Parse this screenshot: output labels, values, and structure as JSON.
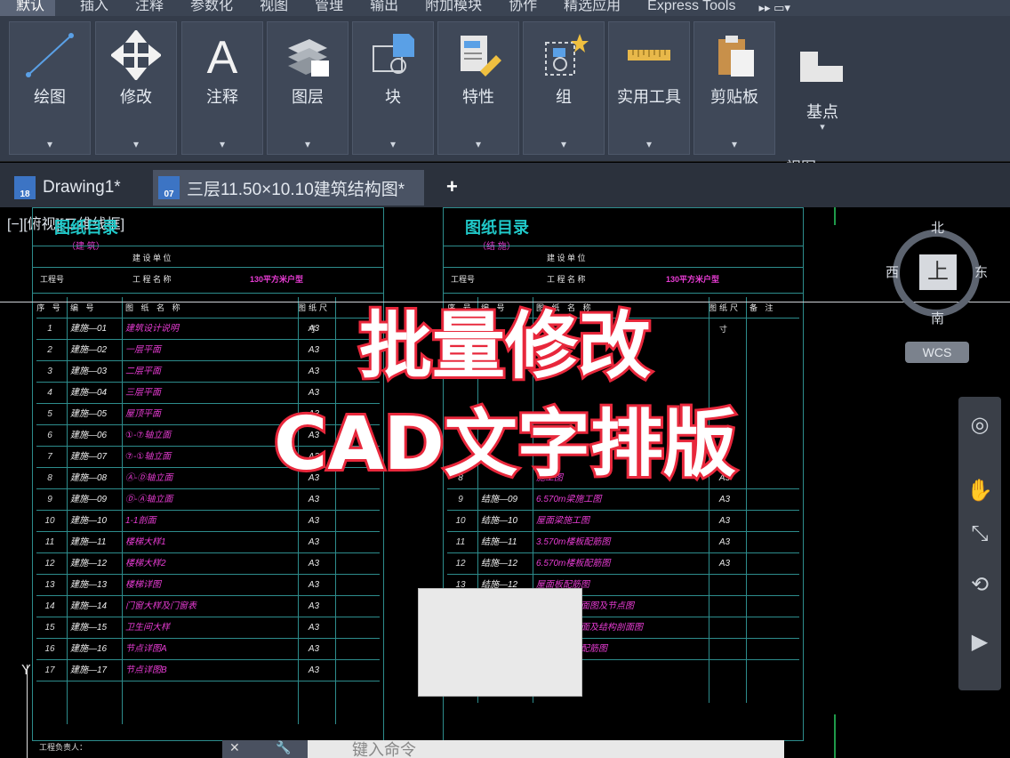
{
  "menu": {
    "tabs": [
      "默认",
      "插入",
      "注释",
      "参数化",
      "视图",
      "管理",
      "输出",
      "附加模块",
      "协作",
      "精选应用",
      "Express Tools"
    ],
    "more": "▸▸ ▭▾"
  },
  "ribbon": {
    "panels": [
      {
        "label": "绘图",
        "icon": "line-draw-icon"
      },
      {
        "label": "修改",
        "icon": "move-arrows-icon"
      },
      {
        "label": "注释",
        "icon": "text-a-icon"
      },
      {
        "label": "图层",
        "icon": "layers-icon"
      },
      {
        "label": "块",
        "icon": "block-icon"
      },
      {
        "label": "特性",
        "icon": "properties-icon"
      },
      {
        "label": "组",
        "icon": "group-icon"
      },
      {
        "label": "实用工具",
        "icon": "ruler-icon"
      },
      {
        "label": "剪贴板",
        "icon": "clipboard-icon"
      }
    ],
    "dropdown_glyph": "▾",
    "basepoint": {
      "label": "基点",
      "view_label": "视图 ▾ ↘"
    }
  },
  "doc_tabs": [
    {
      "label": "Drawing1*",
      "icon_text": "18"
    },
    {
      "label": "三层11.50×10.10建筑结构图*",
      "icon_text": "07"
    }
  ],
  "add_tab": "+",
  "viewport_label": "[−][俯视][二维线框]",
  "sheets": [
    {
      "title": "图纸目录",
      "subtitle": "（建 筑）",
      "builder_label": "建 设 单 位",
      "project_no_label": "工程号",
      "project_name_label": "工 程 名 称",
      "project_name": "130平方米户型",
      "headers": [
        "序 号",
        "编 号",
        "图 纸 名 称",
        "图纸尺寸"
      ],
      "rows": [
        [
          "1",
          "建施—01",
          "建筑设计说明",
          "A3"
        ],
        [
          "2",
          "建施—02",
          "一层平面",
          "A3"
        ],
        [
          "3",
          "建施—03",
          "二层平面",
          "A3"
        ],
        [
          "4",
          "建施—04",
          "三层平面",
          "A3"
        ],
        [
          "5",
          "建施—05",
          "屋顶平面",
          "A3"
        ],
        [
          "6",
          "建施—06",
          "①-⑦轴立面",
          "A3"
        ],
        [
          "7",
          "建施—07",
          "⑦-①轴立面",
          "A3"
        ],
        [
          "8",
          "建施—08",
          "Ⓐ-Ⓓ轴立面",
          "A3"
        ],
        [
          "9",
          "建施—09",
          "Ⓓ-Ⓐ轴立面",
          "A3"
        ],
        [
          "10",
          "建施—10",
          "1-1剖面",
          "A3"
        ],
        [
          "11",
          "建施—11",
          "楼梯大样1",
          "A3"
        ],
        [
          "12",
          "建施—12",
          "楼梯大样2",
          "A3"
        ],
        [
          "13",
          "建施—13",
          "楼梯详图",
          "A3"
        ],
        [
          "14",
          "建施—14",
          "门窗大样及门窗表",
          "A3"
        ],
        [
          "15",
          "建施—15",
          "卫生间大样",
          "A3"
        ],
        [
          "16",
          "建施—16",
          "节点详图A",
          "A3"
        ],
        [
          "17",
          "建施—17",
          "节点详图B",
          "A3"
        ]
      ]
    },
    {
      "title": "图纸目录",
      "subtitle": "（结 施）",
      "builder_label": "建 设 单 位",
      "project_no_label": "工程号",
      "project_name_label": "工 程 名 称",
      "project_name": "130平方米户型",
      "headers": [
        "序 号",
        "编 号",
        "图 纸 名 称",
        "图纸尺寸",
        "备 注"
      ],
      "rows": [
        [
          "8",
          "",
          "施工图",
          "A3"
        ],
        [
          "9",
          "结施—09",
          "6.570m梁施工图",
          "A3"
        ],
        [
          "10",
          "结施—10",
          "屋面梁施工图",
          "A3"
        ],
        [
          "11",
          "结施—11",
          "3.570m楼板配筋图",
          "A3"
        ],
        [
          "12",
          "结施—12",
          "6.570m楼板配筋图",
          "A3"
        ],
        [
          "13",
          "结施—12",
          "屋面板配筋图",
          ""
        ],
        [
          "14",
          "结施—12",
          "楼梯结构平面图及节点图",
          ""
        ],
        [
          "15",
          "结施—12",
          "楼梯结构平面及结构剖面图",
          ""
        ],
        [
          "16",
          "结施—12",
          "楼梯梯段板配筋图",
          ""
        ]
      ]
    }
  ],
  "footer": {
    "responsible": "工程负责人："
  },
  "overlay": {
    "line1": "批量修改",
    "line2": "CAD文字排版"
  },
  "compass": {
    "north": "北",
    "south": "南",
    "east": "东",
    "west": "西",
    "top": "上"
  },
  "wcs": "WCS",
  "command_line": {
    "placeholder": "键入命令"
  },
  "colors": {
    "accent_overlay": "#e8283c",
    "grid_cyan": "#2d8c8c",
    "text_magenta": "#e83cd4"
  }
}
